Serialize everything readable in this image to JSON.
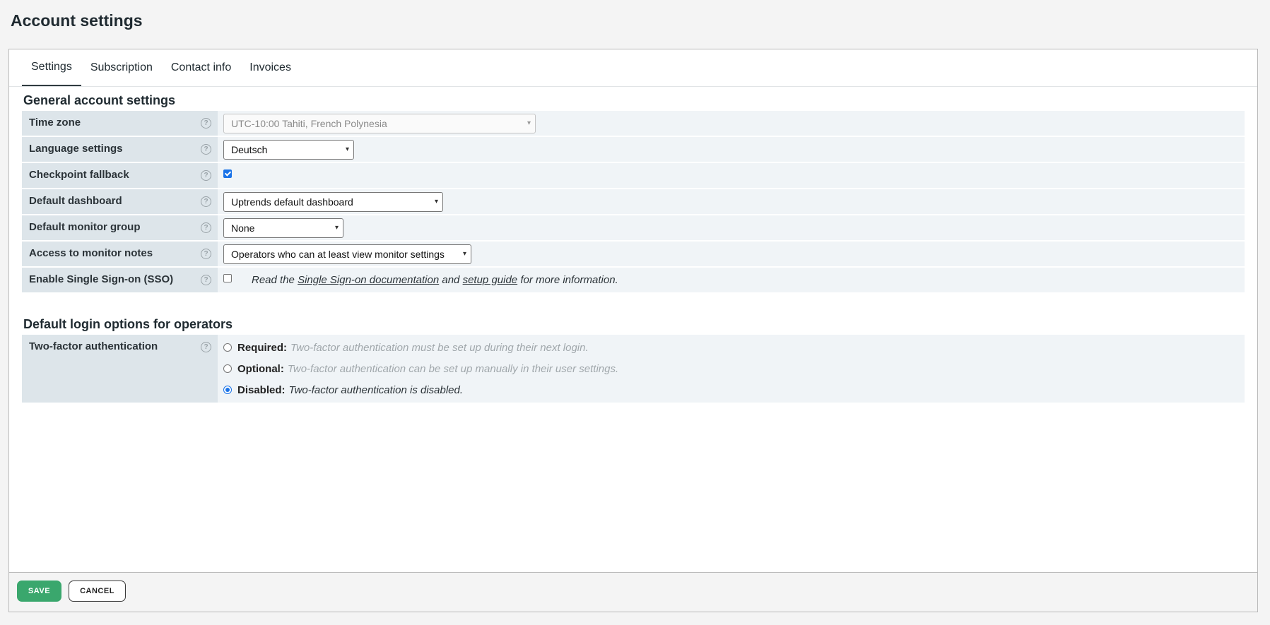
{
  "page": {
    "title": "Account settings"
  },
  "tabs": [
    {
      "label": "Settings",
      "active": true
    },
    {
      "label": "Subscription",
      "active": false
    },
    {
      "label": "Contact info",
      "active": false
    },
    {
      "label": "Invoices",
      "active": false
    }
  ],
  "general": {
    "title": "General account settings",
    "time_zone": {
      "label": "Time zone",
      "value": "UTC-10:00 Tahiti, French Polynesia",
      "disabled": true
    },
    "language": {
      "label": "Language settings",
      "value": "Deutsch"
    },
    "checkpoint_fallback": {
      "label": "Checkpoint fallback",
      "checked": true
    },
    "default_dashboard": {
      "label": "Default dashboard",
      "value": "Uptrends default dashboard"
    },
    "default_monitor_group": {
      "label": "Default monitor group",
      "value": "None"
    },
    "monitor_notes": {
      "label": "Access to monitor notes",
      "value": "Operators who can at least view monitor settings"
    },
    "sso": {
      "label": "Enable Single Sign-on (SSO)",
      "checked": false,
      "text_prefix": "Read the",
      "link1": "Single Sign-on documentation",
      "text_mid": "and",
      "link2": "setup guide",
      "text_suffix": "for more information."
    }
  },
  "login": {
    "title": "Default login options for operators",
    "two_factor": {
      "label": "Two-factor authentication",
      "options": [
        {
          "label": "Required:",
          "desc": "Two-factor authentication must be set up during their next login.",
          "selected": false
        },
        {
          "label": "Optional:",
          "desc": "Two-factor authentication can be set up manually in their user settings.",
          "selected": false
        },
        {
          "label": "Disabled:",
          "desc": "Two-factor authentication is disabled.",
          "selected": true
        }
      ]
    }
  },
  "footer": {
    "save_label": "SAVE",
    "cancel_label": "CANCEL"
  },
  "icons": {
    "help": "help-circle-icon",
    "dropdown": "chevron-down-icon"
  },
  "colors": {
    "save": "#3aa76d",
    "label_bg": "#dde5ea",
    "value_bg": "#f0f4f7",
    "accent": "#1a73e8"
  }
}
